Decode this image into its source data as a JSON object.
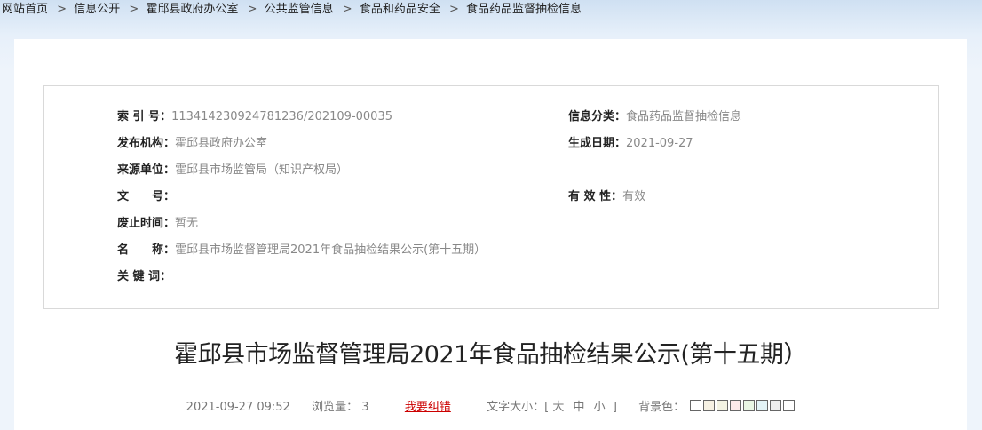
{
  "breadcrumb": {
    "items": [
      "网站首页",
      "信息公开",
      "霍邱县政府办公室",
      "公共监管信息",
      "食品和药品安全",
      "食品药品监督抽检信息"
    ],
    "separator": ">"
  },
  "meta": {
    "index_label": "索 引 号：",
    "index_value": "113414230924781236/202109-00035",
    "category_label": "信息分类：",
    "category_value": "食品药品监督抽检信息",
    "publisher_label": "发布机构：",
    "publisher_value": "霍邱县政府办公室",
    "date_label": "生成日期：",
    "date_value": "2021-09-27",
    "source_label": "来源单位：",
    "source_value": "霍邱县市场监管局（知识产权局）",
    "docno_label": "文　　号：",
    "docno_value": "",
    "validity_label": "有 效 性：",
    "validity_value": "有效",
    "expiry_label": "废止时间：",
    "expiry_value": "暂无",
    "name_label": "名　　称：",
    "name_value": "霍邱县市场监督管理局2021年食品抽检结果公示(第十五期）",
    "keywords_label": "关 键 词：",
    "keywords_value": ""
  },
  "article": {
    "title": "霍邱县市场监督管理局2021年食品抽检结果公示(第十五期）",
    "datetime": "2021-09-27 09:52",
    "views_label": "浏览量：",
    "views": "3",
    "error_link": "我要纠错",
    "font_size_label": "文字大小：[",
    "font_large": "大",
    "font_medium": "中",
    "font_small": "小",
    "font_size_close": "]",
    "bg_label": "背景色：",
    "bg_colors": [
      "#ffffff",
      "#f6f1e3",
      "#f3f3e3",
      "#fdeaea",
      "#e9f6e4",
      "#e3f3f6",
      "#eeeeee",
      "#ffffff"
    ]
  }
}
